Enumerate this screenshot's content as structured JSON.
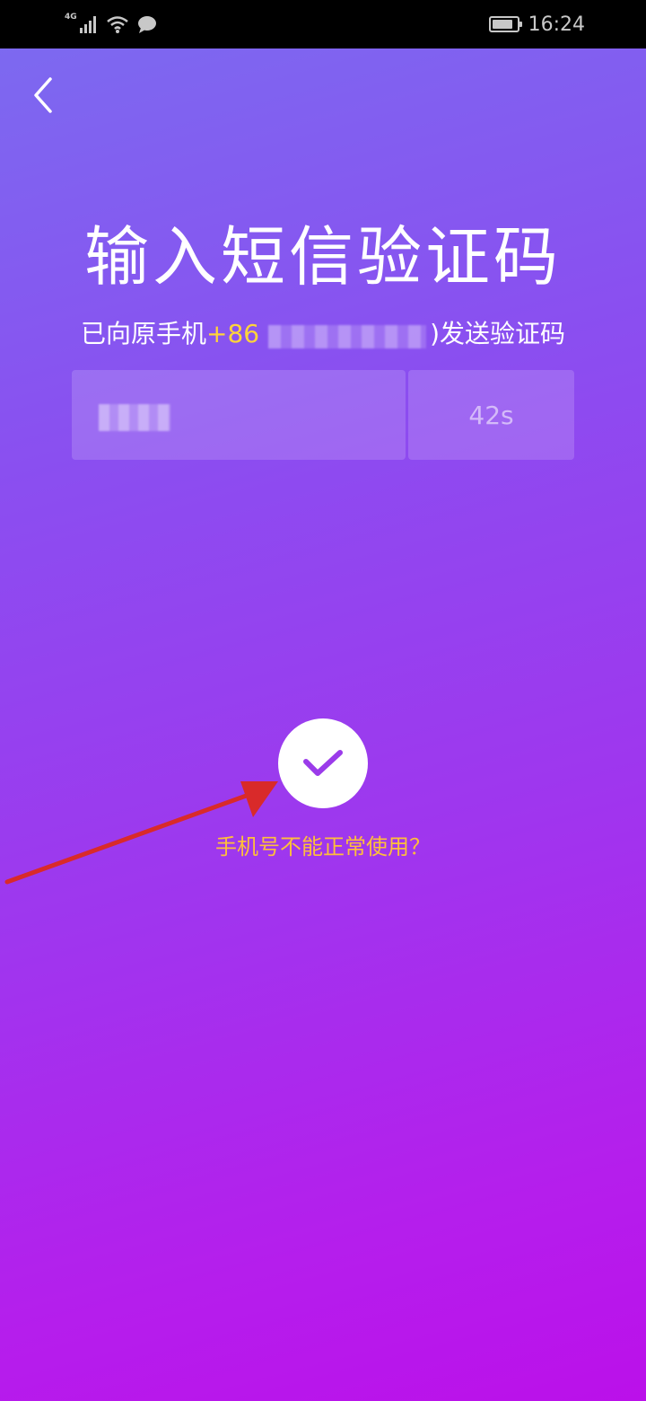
{
  "status_bar": {
    "network": "4G",
    "time": "16:24"
  },
  "header": {
    "back_icon": "chevron-left-icon"
  },
  "main": {
    "title": "输入短信验证码",
    "subtitle_prefix": "已向原手机",
    "country_code": "+86",
    "subtitle_suffix": ")发送验证码",
    "countdown": "42s",
    "confirm_icon": "check-icon",
    "help_link": "手机号不能正常使用？"
  },
  "colors": {
    "accent_yellow": "#ffd43a",
    "help_orange": "#ffbf3a",
    "check_purple": "#9b3bea",
    "arrow_red": "#d92a2a"
  }
}
